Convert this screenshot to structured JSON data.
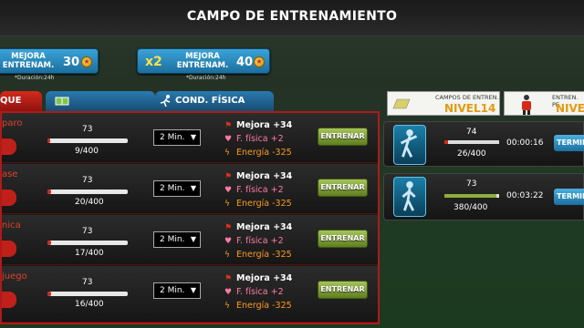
{
  "header": {
    "title": "CAMPO DE ENTRENAMIENTO"
  },
  "boosts": [
    {
      "label_line1": "MEJORA",
      "label_line2": "ENTRENAM.",
      "value": "30",
      "duration": "*Duración:24h",
      "multiplier": ""
    },
    {
      "label_line1": "MEJORA",
      "label_line2": "ENTRENAM.",
      "value": "40",
      "duration": "*Duración:24h",
      "multiplier": "x2"
    }
  ],
  "tabs": [
    {
      "label": "QUE",
      "icon": "",
      "active": true
    },
    {
      "label": "",
      "icon": "field-icon",
      "active": false
    },
    {
      "label": "COND. FÍSICA",
      "icon": "runner-icon",
      "active": false
    }
  ],
  "cards": [
    {
      "title": "CAMPOS DE ENTREN.",
      "value": "NIVEL14"
    },
    {
      "title": "ENTREN. PE",
      "value": "NIVE"
    }
  ],
  "trainings": [
    {
      "name": "paro",
      "level": "73",
      "progress": "9/400",
      "fill": 0.0225,
      "duration": "2 Min.",
      "effect1": "Mejora +34",
      "effect2": "F. física +2",
      "effect3": "Energía -325",
      "button": "ENTRENAR"
    },
    {
      "name": "ase",
      "level": "73",
      "progress": "20/400",
      "fill": 0.05,
      "duration": "2 Min.",
      "effect1": "Mejora +34",
      "effect2": "F. física +2",
      "effect3": "Energía -325",
      "button": "ENTRENAR"
    },
    {
      "name": "nica",
      "level": "73",
      "progress": "17/400",
      "fill": 0.0425,
      "duration": "2 Min.",
      "effect1": "Mejora +34",
      "effect2": "F. física +2",
      "effect3": "Energía -325",
      "button": "ENTRENAR"
    },
    {
      "name": "juego",
      "level": "73",
      "progress": "16/400",
      "fill": 0.04,
      "duration": "2 Min.",
      "effect1": "Mejora +34",
      "effect2": "F. física +2",
      "effect3": "Energía -325",
      "button": "ENTRENAR"
    }
  ],
  "active": [
    {
      "level": "74",
      "progress": "26/400",
      "fill": 0.065,
      "time": "00:00:16",
      "button": "TERMINAR",
      "bar_color": "#d02a1a"
    },
    {
      "level": "73",
      "progress": "380/400",
      "fill": 0.95,
      "time": "00:03:22",
      "button": "TERMINAR",
      "bar_color": "#8fae3c"
    }
  ]
}
